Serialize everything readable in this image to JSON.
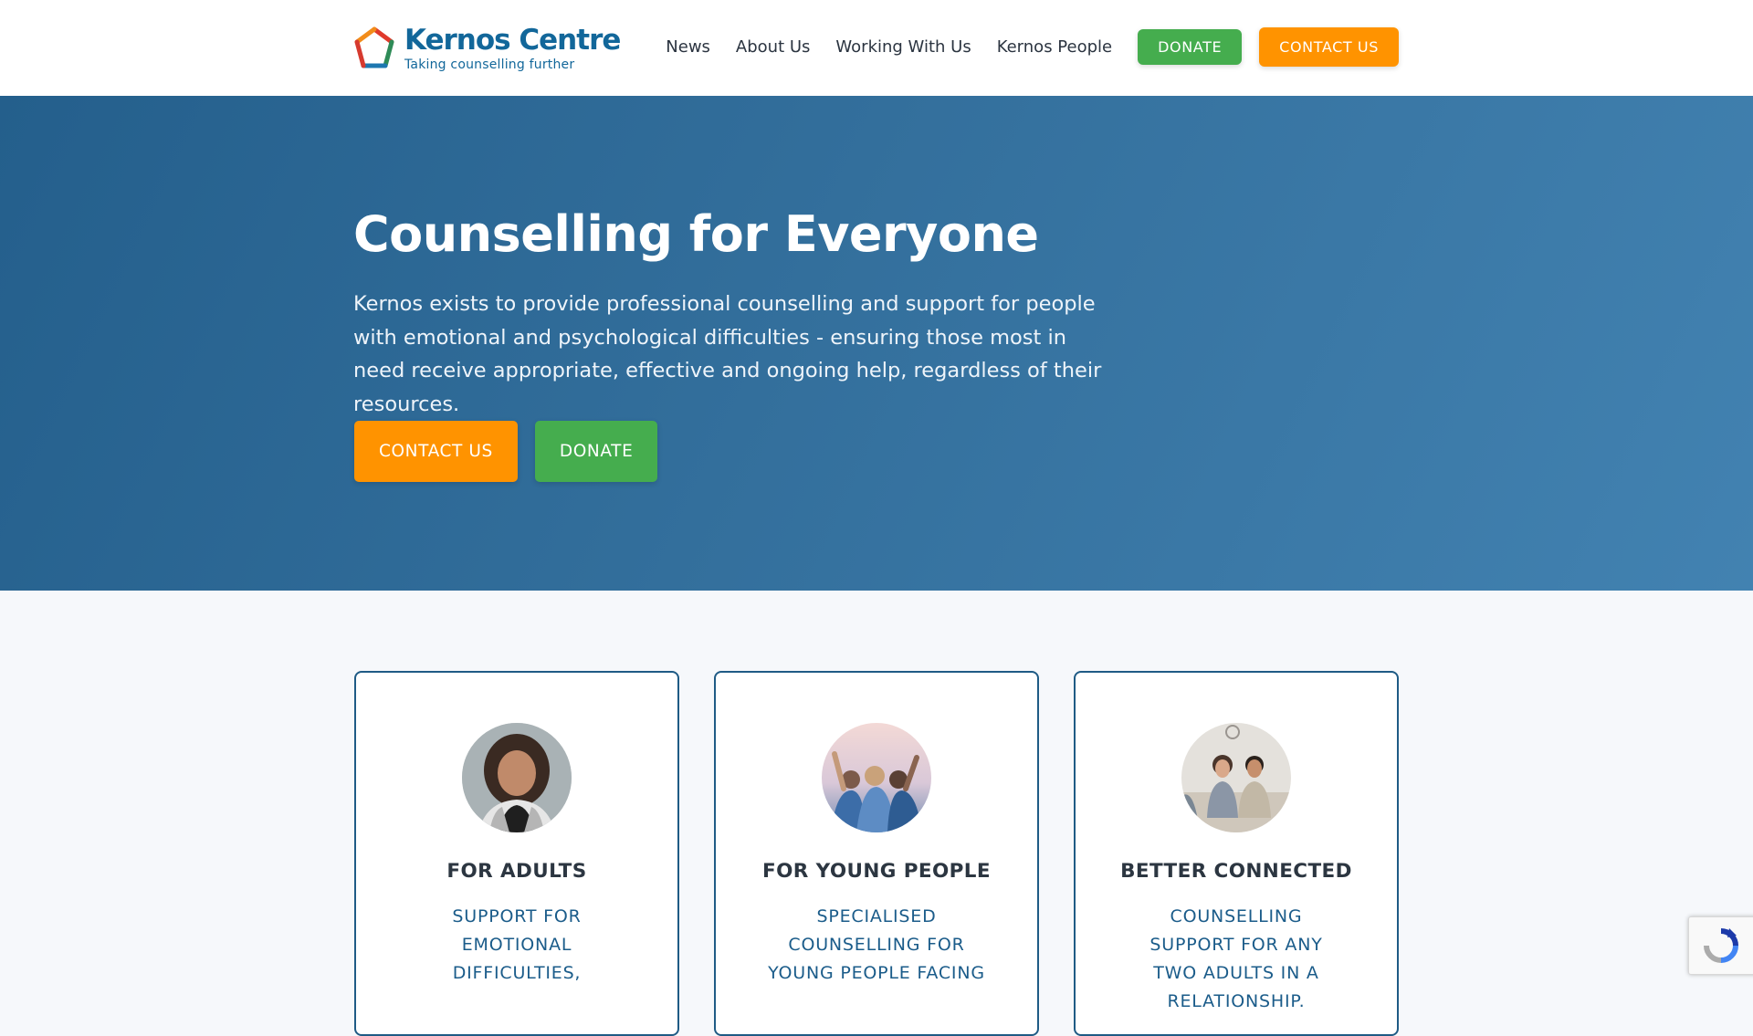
{
  "brand": {
    "name": "Kernos Centre",
    "tagline": "Taking counselling further",
    "colors": {
      "primary": "#12679a",
      "green": "#45ad4e",
      "orange": "#ff9300",
      "red": "#d63a2f"
    }
  },
  "nav": {
    "links": [
      "News",
      "About Us",
      "Working With Us",
      "Kernos People"
    ],
    "donate_label": "DONATE",
    "contact_label": "CONTACT US"
  },
  "hero": {
    "title": "Counselling for Everyone",
    "text": "Kernos exists to provide professional counselling and support for people with emotional and psychological difficulties - ensuring those most in need receive appropriate, effective and ongoing help, regardless of their resources.",
    "contact_label": "CONTACT US",
    "donate_label": "DONATE"
  },
  "cards": [
    {
      "title": "FOR ADULTS",
      "subtitle": "SUPPORT FOR EMOTIONAL DIFFICULTIES,",
      "image": "woman-portrait"
    },
    {
      "title": "FOR YOUNG PEOPLE",
      "subtitle": "SPECIALISED COUNSELLING FOR YOUNG PEOPLE FACING",
      "image": "young-people-group"
    },
    {
      "title": "BETTER CONNECTED",
      "subtitle": "COUNSELLING SUPPORT FOR ANY TWO ADULTS IN A RELATIONSHIP.",
      "image": "couple-counselling"
    }
  ],
  "recaptcha": {
    "icon": "recaptcha-icon"
  }
}
